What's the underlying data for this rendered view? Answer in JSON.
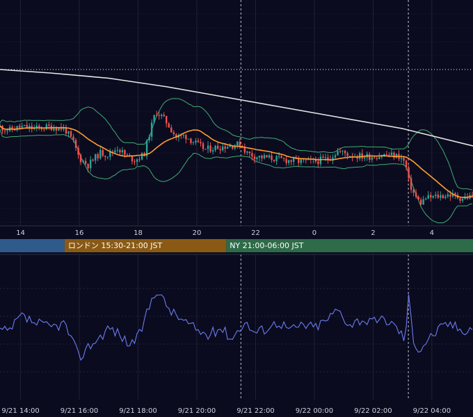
{
  "chart_data": [
    {
      "type": "candlestick",
      "name_hint": "price-panel",
      "x_ticks": [
        "14",
        "16",
        "18",
        "20",
        "22",
        "0",
        "2",
        "4"
      ],
      "x_tick_hours": [
        14,
        16,
        18,
        20,
        22,
        24,
        26,
        28
      ],
      "x_range_hours": [
        13.3,
        29.4
      ],
      "y_range": [
        0,
        100
      ],
      "ylim_note": "price axis not printed",
      "price_anchors": [
        [
          13.3,
          55
        ],
        [
          13.6,
          53
        ],
        [
          14.0,
          55
        ],
        [
          14.5,
          54
        ],
        [
          15.0,
          55
        ],
        [
          15.5,
          54
        ],
        [
          15.8,
          46
        ],
        [
          16.0,
          37
        ],
        [
          16.3,
          33
        ],
        [
          16.7,
          40
        ],
        [
          17.0,
          39
        ],
        [
          17.3,
          43
        ],
        [
          17.6,
          38
        ],
        [
          17.9,
          36
        ],
        [
          18.2,
          39
        ],
        [
          18.4,
          52
        ],
        [
          18.6,
          64
        ],
        [
          18.8,
          61
        ],
        [
          19.0,
          57
        ],
        [
          19.3,
          49
        ],
        [
          19.6,
          50
        ],
        [
          20.0,
          45
        ],
        [
          20.3,
          42
        ],
        [
          20.6,
          43
        ],
        [
          21.0,
          44
        ],
        [
          21.5,
          45
        ],
        [
          21.7,
          40
        ],
        [
          22.0,
          38
        ],
        [
          22.5,
          37
        ],
        [
          23.0,
          36
        ],
        [
          23.5,
          35
        ],
        [
          24.0,
          35
        ],
        [
          24.5,
          37
        ],
        [
          24.8,
          41
        ],
        [
          25.2,
          39
        ],
        [
          25.6,
          38
        ],
        [
          26.0,
          38
        ],
        [
          26.5,
          39
        ],
        [
          26.9,
          38
        ],
        [
          27.1,
          34
        ],
        [
          27.2,
          24
        ],
        [
          27.4,
          16
        ],
        [
          27.6,
          11
        ],
        [
          27.8,
          14
        ],
        [
          28.2,
          15
        ],
        [
          28.6,
          16
        ],
        [
          29.0,
          14
        ],
        [
          29.4,
          15
        ]
      ],
      "long_ma": [
        [
          13.3,
          88
        ],
        [
          15.0,
          86
        ],
        [
          17.0,
          83
        ],
        [
          19.0,
          78
        ],
        [
          21.0,
          72
        ],
        [
          23.0,
          66
        ],
        [
          25.0,
          60
        ],
        [
          27.0,
          54
        ],
        [
          29.4,
          44
        ]
      ],
      "ref_line_level": 88,
      "session_markers_hours": [
        21.5,
        27.2
      ],
      "sessions": [
        {
          "label": "",
          "color": "#2f5a8c",
          "start": 13.3,
          "end": 15.5
        },
        {
          "label": "ロンドン 15:30-21:00 JST",
          "color": "#8a5a14",
          "start": 15.5,
          "end": 21.0
        },
        {
          "label": "NY 21:00-06:00 JST",
          "color": "#2e6b48",
          "start": 21.0,
          "end": 29.4
        }
      ],
      "colors": {
        "background": "#0b0b1f",
        "grid": "#2c3046",
        "up": "#26a69a",
        "down": "#ef5350",
        "ma_short": "#ff9f30",
        "ma_long": "#e8e8e8",
        "bands": "#3fae74",
        "ref_line": "#ffffff",
        "session_marker": "#bfc3cc"
      }
    },
    {
      "type": "line",
      "name_hint": "oscillator-panel",
      "x_ticks": [
        "9/21 14:00",
        "9/21 16:00",
        "9/21 18:00",
        "9/21 20:00",
        "9/21 22:00",
        "9/22 00:00",
        "9/22 02:00",
        "9/22 04:00"
      ],
      "x_tick_hours": [
        14,
        16,
        18,
        20,
        22,
        24,
        26,
        28
      ],
      "y_range": [
        0,
        100
      ],
      "grid_levels": [
        80,
        60,
        40,
        20
      ],
      "line_color": "#6b7df0",
      "osc_anchors": [
        [
          13.3,
          50
        ],
        [
          13.6,
          48
        ],
        [
          14.0,
          60
        ],
        [
          14.5,
          55
        ],
        [
          15.0,
          52
        ],
        [
          15.5,
          55
        ],
        [
          15.8,
          40
        ],
        [
          16.0,
          30
        ],
        [
          16.3,
          38
        ],
        [
          16.7,
          45
        ],
        [
          17.0,
          52
        ],
        [
          17.3,
          48
        ],
        [
          17.7,
          40
        ],
        [
          18.0,
          44
        ],
        [
          18.3,
          62
        ],
        [
          18.6,
          80
        ],
        [
          18.9,
          70
        ],
        [
          19.2,
          62
        ],
        [
          19.6,
          56
        ],
        [
          20.0,
          50
        ],
        [
          20.4,
          46
        ],
        [
          20.8,
          52
        ],
        [
          21.2,
          44
        ],
        [
          21.6,
          56
        ],
        [
          22.0,
          48
        ],
        [
          22.4,
          52
        ],
        [
          22.8,
          56
        ],
        [
          23.2,
          50
        ],
        [
          23.6,
          54
        ],
        [
          24.0,
          52
        ],
        [
          24.4,
          57
        ],
        [
          24.8,
          65
        ],
        [
          25.2,
          54
        ],
        [
          25.6,
          58
        ],
        [
          26.0,
          55
        ],
        [
          26.4,
          58
        ],
        [
          26.8,
          52
        ],
        [
          27.1,
          43
        ],
        [
          27.2,
          75
        ],
        [
          27.4,
          40
        ],
        [
          27.6,
          36
        ],
        [
          27.8,
          42
        ],
        [
          28.2,
          50
        ],
        [
          28.6,
          55
        ],
        [
          29.0,
          50
        ],
        [
          29.4,
          52
        ]
      ]
    }
  ]
}
